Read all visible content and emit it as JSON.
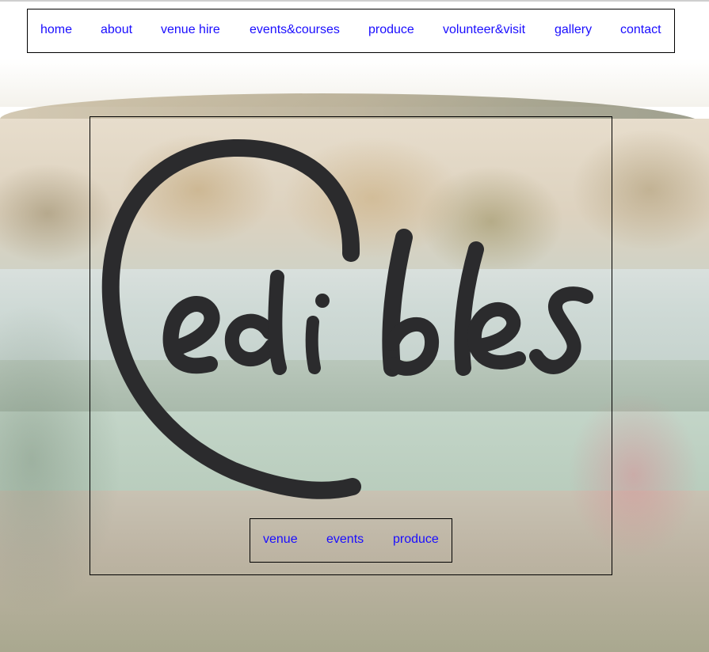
{
  "top_nav": {
    "items": [
      {
        "label": "home"
      },
      {
        "label": "about"
      },
      {
        "label": "venue hire"
      },
      {
        "label": "events&courses"
      },
      {
        "label": "produce"
      },
      {
        "label": "volunteer&visit"
      },
      {
        "label": "gallery"
      },
      {
        "label": "contact"
      }
    ]
  },
  "logo": {
    "text": "edibles",
    "color": "#2b2b2d"
  },
  "sub_nav": {
    "items": [
      {
        "label": "venue"
      },
      {
        "label": "events"
      },
      {
        "label": "produce"
      }
    ]
  },
  "colors": {
    "link": "#1a0dff",
    "border": "#000000"
  }
}
